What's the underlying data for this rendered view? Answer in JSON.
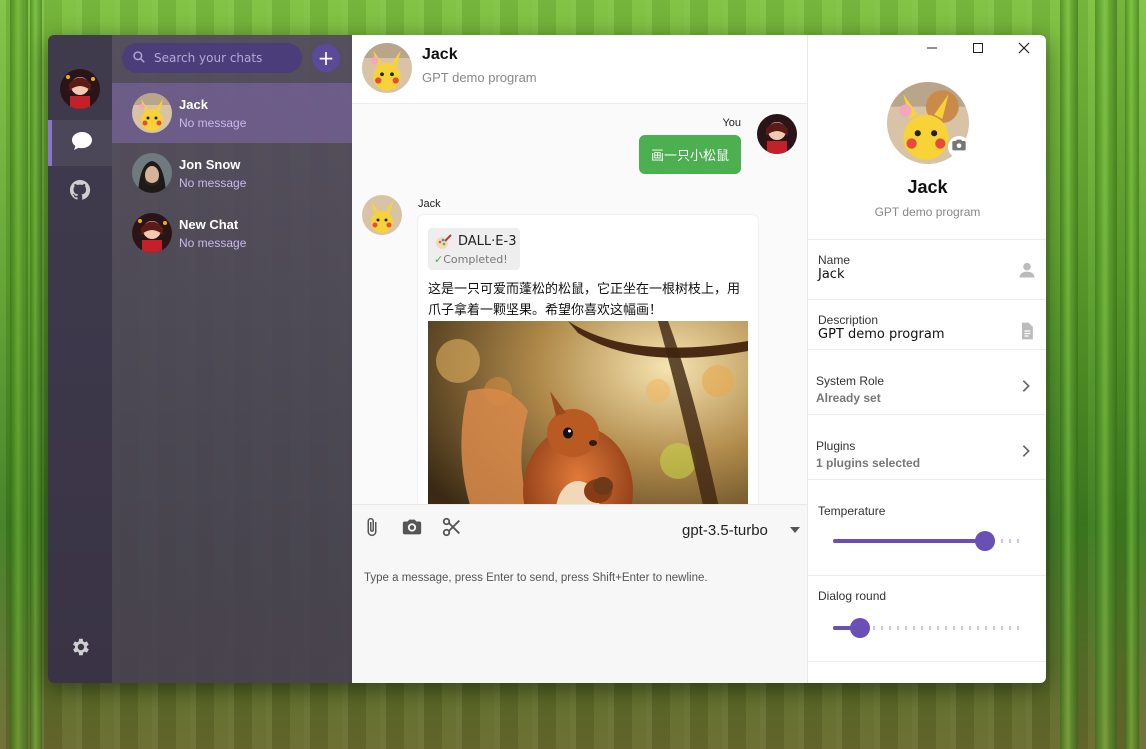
{
  "colors": {
    "accent": "#6a4fb4",
    "sent_bubble": "#4caf50"
  },
  "sidebar_rail": {
    "items": [
      {
        "icon": "chat-bubble-icon",
        "active": true
      },
      {
        "icon": "github-icon",
        "active": false
      }
    ],
    "settings_icon": "gear-icon"
  },
  "chat_list": {
    "search_placeholder": "Search your chats",
    "add_icon": "+",
    "conversations": [
      {
        "name": "Jack",
        "subtitle": "No message"
      },
      {
        "name": "Jon Snow",
        "subtitle": "No message"
      },
      {
        "name": "New Chat",
        "subtitle": "No message"
      }
    ]
  },
  "chat_header": {
    "title": "Jack",
    "subtitle": "GPT demo program"
  },
  "messages": {
    "me": {
      "sender": "You",
      "text": "画一只小松鼠"
    },
    "ai": {
      "sender": "Jack",
      "plugin_name": "DALL·E-3",
      "plugin_status": "Completed!",
      "text": "这是一只可爱而蓬松的松鼠，它正坐在一根树枝上，用爪子拿着一颗坚果。希望你喜欢这幅画！"
    }
  },
  "composer": {
    "model": "gpt-3.5-turbo",
    "placeholder": "Type a message, press Enter to send, press Shift+Enter to newline."
  },
  "profile_panel": {
    "name": "Jack",
    "description": "GPT demo program",
    "name_label": "Name",
    "name_value": "Jack",
    "description_label": "Description",
    "description_value": "GPT demo program",
    "system_role_label": "System Role",
    "system_role_value": "Already set",
    "plugins_label": "Plugins",
    "plugins_value": "1 plugins selected",
    "temperature_label": "Temperature",
    "temperature_fraction": 0.8,
    "dialog_round_label": "Dialog round",
    "dialog_round_fraction": 0.14
  }
}
